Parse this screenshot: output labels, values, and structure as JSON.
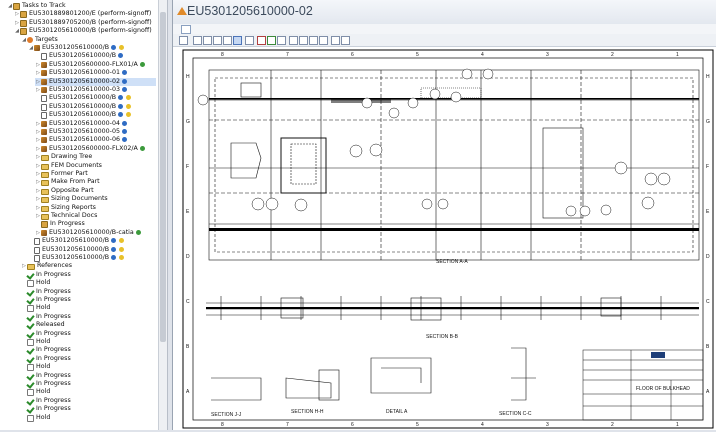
{
  "window": {
    "title": "EU5301205610000-02"
  },
  "tree": [
    {
      "indent": 1,
      "twisty": "◢",
      "icon": "task",
      "label": "Tasks to Track"
    },
    {
      "indent": 2,
      "twisty": "▷",
      "icon": "task",
      "label": "EU5301889801200/E (perform-signoff)"
    },
    {
      "indent": 2,
      "twisty": "▷",
      "icon": "task",
      "label": "EU5301889705200/B (perform-signoff)"
    },
    {
      "indent": 2,
      "twisty": "◢",
      "icon": "task",
      "label": "EU5301205610000/B (perform-signoff)"
    },
    {
      "indent": 3,
      "twisty": "◢",
      "icon": "target",
      "label": "Targets"
    },
    {
      "indent": 4,
      "twisty": "◢",
      "icon": "part",
      "label": "EU5301205610000/B",
      "stats": [
        "b",
        "y"
      ]
    },
    {
      "indent": 5,
      "twisty": "",
      "icon": "doc",
      "label": "EU5301205610000/B",
      "stats": [
        "b"
      ]
    },
    {
      "indent": 5,
      "twisty": "▷",
      "icon": "part",
      "label": "EU5301205600000-FLX01/A",
      "stats": [
        "g"
      ]
    },
    {
      "indent": 5,
      "twisty": "▷",
      "icon": "part",
      "label": "EU5301205610000-01",
      "stats": [
        "b"
      ]
    },
    {
      "indent": 5,
      "twisty": "▷",
      "icon": "part",
      "label": "EU5301205610000-02",
      "stats": [
        "b"
      ],
      "selected": true
    },
    {
      "indent": 5,
      "twisty": "▷",
      "icon": "part",
      "label": "EU5301205610000-03",
      "stats": [
        "b"
      ]
    },
    {
      "indent": 5,
      "twisty": "",
      "icon": "doc",
      "label": "EU5301205610000/B",
      "stats": [
        "b",
        "y"
      ]
    },
    {
      "indent": 5,
      "twisty": "",
      "icon": "doc",
      "label": "EU5301205610000/B",
      "stats": [
        "b",
        "y"
      ]
    },
    {
      "indent": 5,
      "twisty": "",
      "icon": "doc",
      "label": "EU5301205610000/B",
      "stats": [
        "b",
        "y"
      ]
    },
    {
      "indent": 5,
      "twisty": "▷",
      "icon": "part",
      "label": "EU5301205610000-04",
      "stats": [
        "b"
      ]
    },
    {
      "indent": 5,
      "twisty": "▷",
      "icon": "part",
      "label": "EU5301205610000-05",
      "stats": [
        "b"
      ]
    },
    {
      "indent": 5,
      "twisty": "▷",
      "icon": "part",
      "label": "EU5301205610000-06",
      "stats": [
        "b"
      ]
    },
    {
      "indent": 5,
      "twisty": "▷",
      "icon": "part",
      "label": "EU5301205600000-FLX02/A",
      "stats": [
        "g"
      ]
    },
    {
      "indent": 5,
      "twisty": "▷",
      "icon": "folder",
      "label": "Drawing Tree"
    },
    {
      "indent": 5,
      "twisty": "▷",
      "icon": "folder",
      "label": "FEM Documents"
    },
    {
      "indent": 5,
      "twisty": "▷",
      "icon": "folder",
      "label": "Former Part"
    },
    {
      "indent": 5,
      "twisty": "▷",
      "icon": "folder",
      "label": "Make From Part"
    },
    {
      "indent": 5,
      "twisty": "▷",
      "icon": "folder",
      "label": "Opposite Part"
    },
    {
      "indent": 5,
      "twisty": "▷",
      "icon": "folder",
      "label": "Sizing Documents"
    },
    {
      "indent": 5,
      "twisty": "▷",
      "icon": "folder",
      "label": "Sizing Reports"
    },
    {
      "indent": 5,
      "twisty": "▷",
      "icon": "folder",
      "label": "Technical Docs"
    },
    {
      "indent": 5,
      "twisty": "",
      "icon": "task",
      "label": "In Progress"
    },
    {
      "indent": 5,
      "twisty": "▷",
      "icon": "part",
      "label": "EU5301205610000/B-catia",
      "stats": [
        "g"
      ]
    },
    {
      "indent": 4,
      "twisty": "",
      "icon": "doc",
      "label": "EU5301205610000/B",
      "stats": [
        "b",
        "y"
      ]
    },
    {
      "indent": 4,
      "twisty": "",
      "icon": "doc",
      "label": "EU5301205610000/B",
      "stats": [
        "b",
        "y"
      ]
    },
    {
      "indent": 4,
      "twisty": "",
      "icon": "doc",
      "label": "EU5301205610000/B",
      "stats": [
        "b",
        "y"
      ]
    },
    {
      "indent": 3,
      "twisty": "▷",
      "icon": "folder",
      "label": "References"
    },
    {
      "indent": 3,
      "twisty": "",
      "icon": "check",
      "label": "In Progress"
    },
    {
      "indent": 3,
      "twisty": "",
      "icon": "hold",
      "label": "Hold"
    },
    {
      "indent": 3,
      "twisty": "",
      "icon": "check",
      "label": "In Progress"
    },
    {
      "indent": 3,
      "twisty": "",
      "icon": "check",
      "label": "In Progress"
    },
    {
      "indent": 3,
      "twisty": "",
      "icon": "hold",
      "label": "Hold"
    },
    {
      "indent": 3,
      "twisty": "",
      "icon": "check",
      "label": "In Progress"
    },
    {
      "indent": 3,
      "twisty": "",
      "icon": "check",
      "label": "Released"
    },
    {
      "indent": 3,
      "twisty": "",
      "icon": "check",
      "label": "In Progress"
    },
    {
      "indent": 3,
      "twisty": "",
      "icon": "hold",
      "label": "Hold"
    },
    {
      "indent": 3,
      "twisty": "",
      "icon": "check",
      "label": "In Progress"
    },
    {
      "indent": 3,
      "twisty": "",
      "icon": "check",
      "label": "In Progress"
    },
    {
      "indent": 3,
      "twisty": "",
      "icon": "hold",
      "label": "Hold"
    },
    {
      "indent": 3,
      "twisty": "",
      "icon": "check",
      "label": "In Progress"
    },
    {
      "indent": 3,
      "twisty": "",
      "icon": "check",
      "label": "In Progress"
    },
    {
      "indent": 3,
      "twisty": "",
      "icon": "hold",
      "label": "Hold"
    },
    {
      "indent": 3,
      "twisty": "",
      "icon": "check",
      "label": "In Progress"
    },
    {
      "indent": 3,
      "twisty": "",
      "icon": "check",
      "label": "In Progress"
    },
    {
      "indent": 3,
      "twisty": "",
      "icon": "hold",
      "label": "Hold"
    }
  ],
  "drawing": {
    "grid_top": [
      "8",
      "7",
      "6",
      "5",
      "4",
      "3",
      "2",
      "1"
    ],
    "grid_side": [
      "H",
      "G",
      "F",
      "E",
      "D",
      "C",
      "B",
      "A"
    ],
    "sections": [
      "SECTION A-A",
      "SECTION B-B",
      "SECTION C-C",
      "SECTION H-H",
      "SECTION J-J",
      "DETAIL A"
    ],
    "title_block": {
      "drawing_no": "FLOOR OF BULKHEAD"
    }
  }
}
